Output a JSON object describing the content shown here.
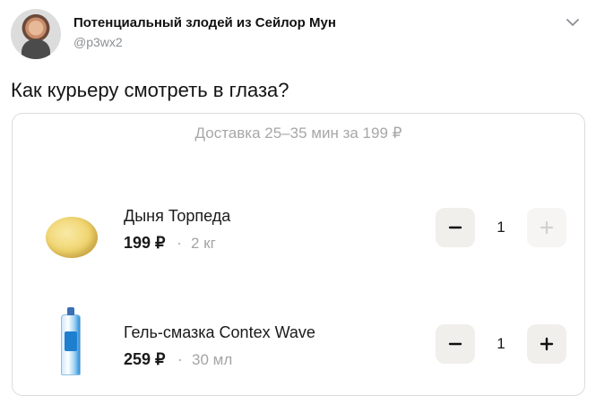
{
  "tweet": {
    "author_name": "Потенциальный злодей из Сейлор Мун",
    "author_handle": "@p3wx2",
    "text": "Как курьеру смотреть в глаза?",
    "menu_icon": "chevron-down-icon"
  },
  "card": {
    "delivery_text": "Доставка 25–35 мин за 199 ₽",
    "items": [
      {
        "name": "Дыня Торпеда",
        "price": "199 ₽",
        "separator": "·",
        "weight": "2 кг",
        "quantity": "1",
        "image_icon": "melon-icon",
        "plus_enabled": false
      },
      {
        "name": "Гель-смазка Contex Wave",
        "price": "259 ₽",
        "separator": "·",
        "weight": "30 мл",
        "quantity": "1",
        "image_icon": "gel-tube-icon",
        "plus_enabled": true
      }
    ]
  },
  "colors": {
    "button_bg": "#f1efec",
    "muted_text": "#a7a7a7",
    "plus_disabled": "#d0d0d0"
  }
}
